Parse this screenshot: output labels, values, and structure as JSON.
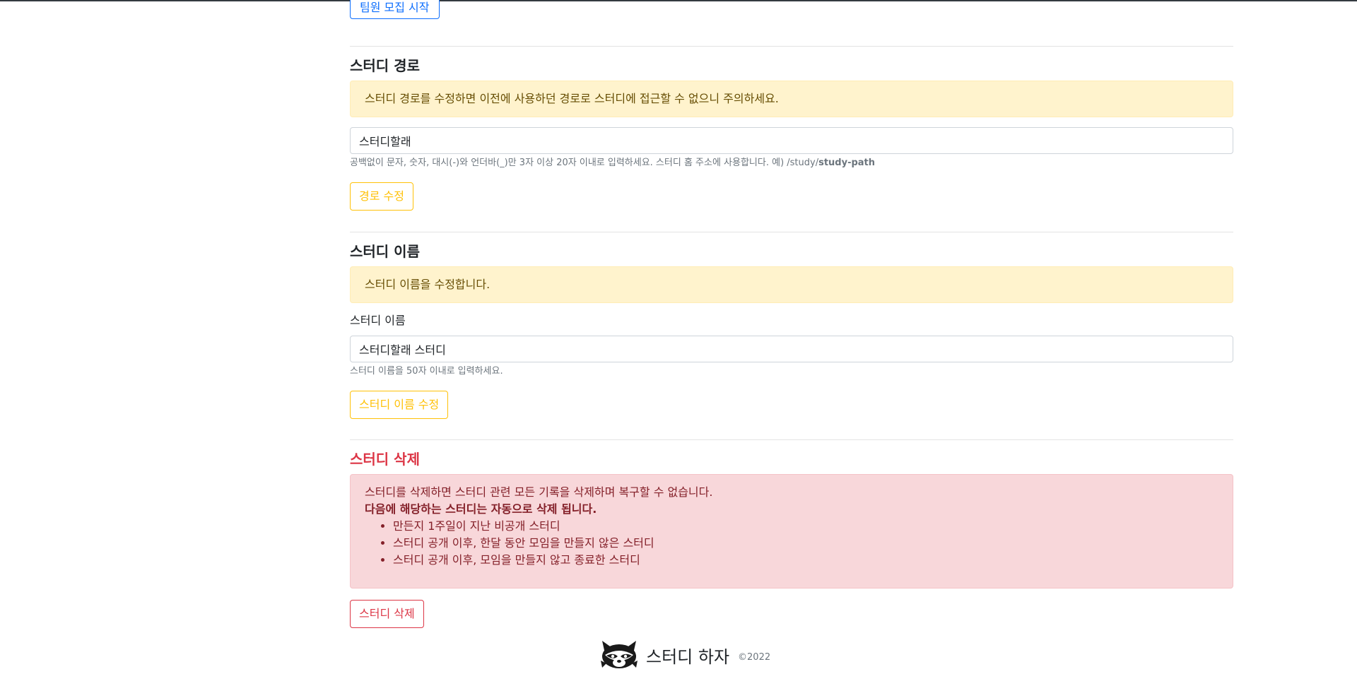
{
  "recruit": {
    "start_button": "팀원 모집 시작"
  },
  "path_section": {
    "title": "스터디 경로",
    "alert": "스터디 경로를 수정하면 이전에 사용하던 경로로 스터디에 접근할 수 없으니 주의하세요.",
    "input_value": "스터디할래",
    "help_prefix": "공백없이 문자, 숫자, 대시(-)와 언더바(_)만 3자 이상 20자 이내로 입력하세요. 스터디 홈 주소에 사용합니다. 예) /study/",
    "help_example": "study-path",
    "submit_button": "경로 수정"
  },
  "name_section": {
    "title": "스터디 이름",
    "alert": "스터디 이름을 수정합니다.",
    "label": "스터디 이름",
    "input_value": "스터디할래 스터디",
    "help": "스터디 이름을 50자 이내로 입력하세요.",
    "submit_button": "스터디 이름 수정"
  },
  "delete_section": {
    "title": "스터디 삭제",
    "alert_line1": "스터디를 삭제하면 스터디 관련 모든 기록을 삭제하며 복구할 수 없습니다.",
    "alert_line2": "다음에 해당하는 스터디는 자동으로 삭제 됩니다.",
    "rules": [
      "만든지 1주일이 지난 비공개 스터디",
      "스터디 공개 이후, 한달 동안 모임을 만들지 않은 스터디",
      "스터디 공개 이후, 모임을 만들지 않고 종료한 스터디"
    ],
    "delete_button": "스터디 삭제"
  },
  "footer": {
    "brand": "스터디 하자",
    "copyright": "©2022",
    "logo_icon": "raccoon-logo-icon"
  },
  "colors": {
    "primary": "#0d6efd",
    "warning": "#ffc107",
    "danger": "#dc3545",
    "warning_bg": "#fff3cd",
    "danger_bg": "#f8d7da"
  }
}
